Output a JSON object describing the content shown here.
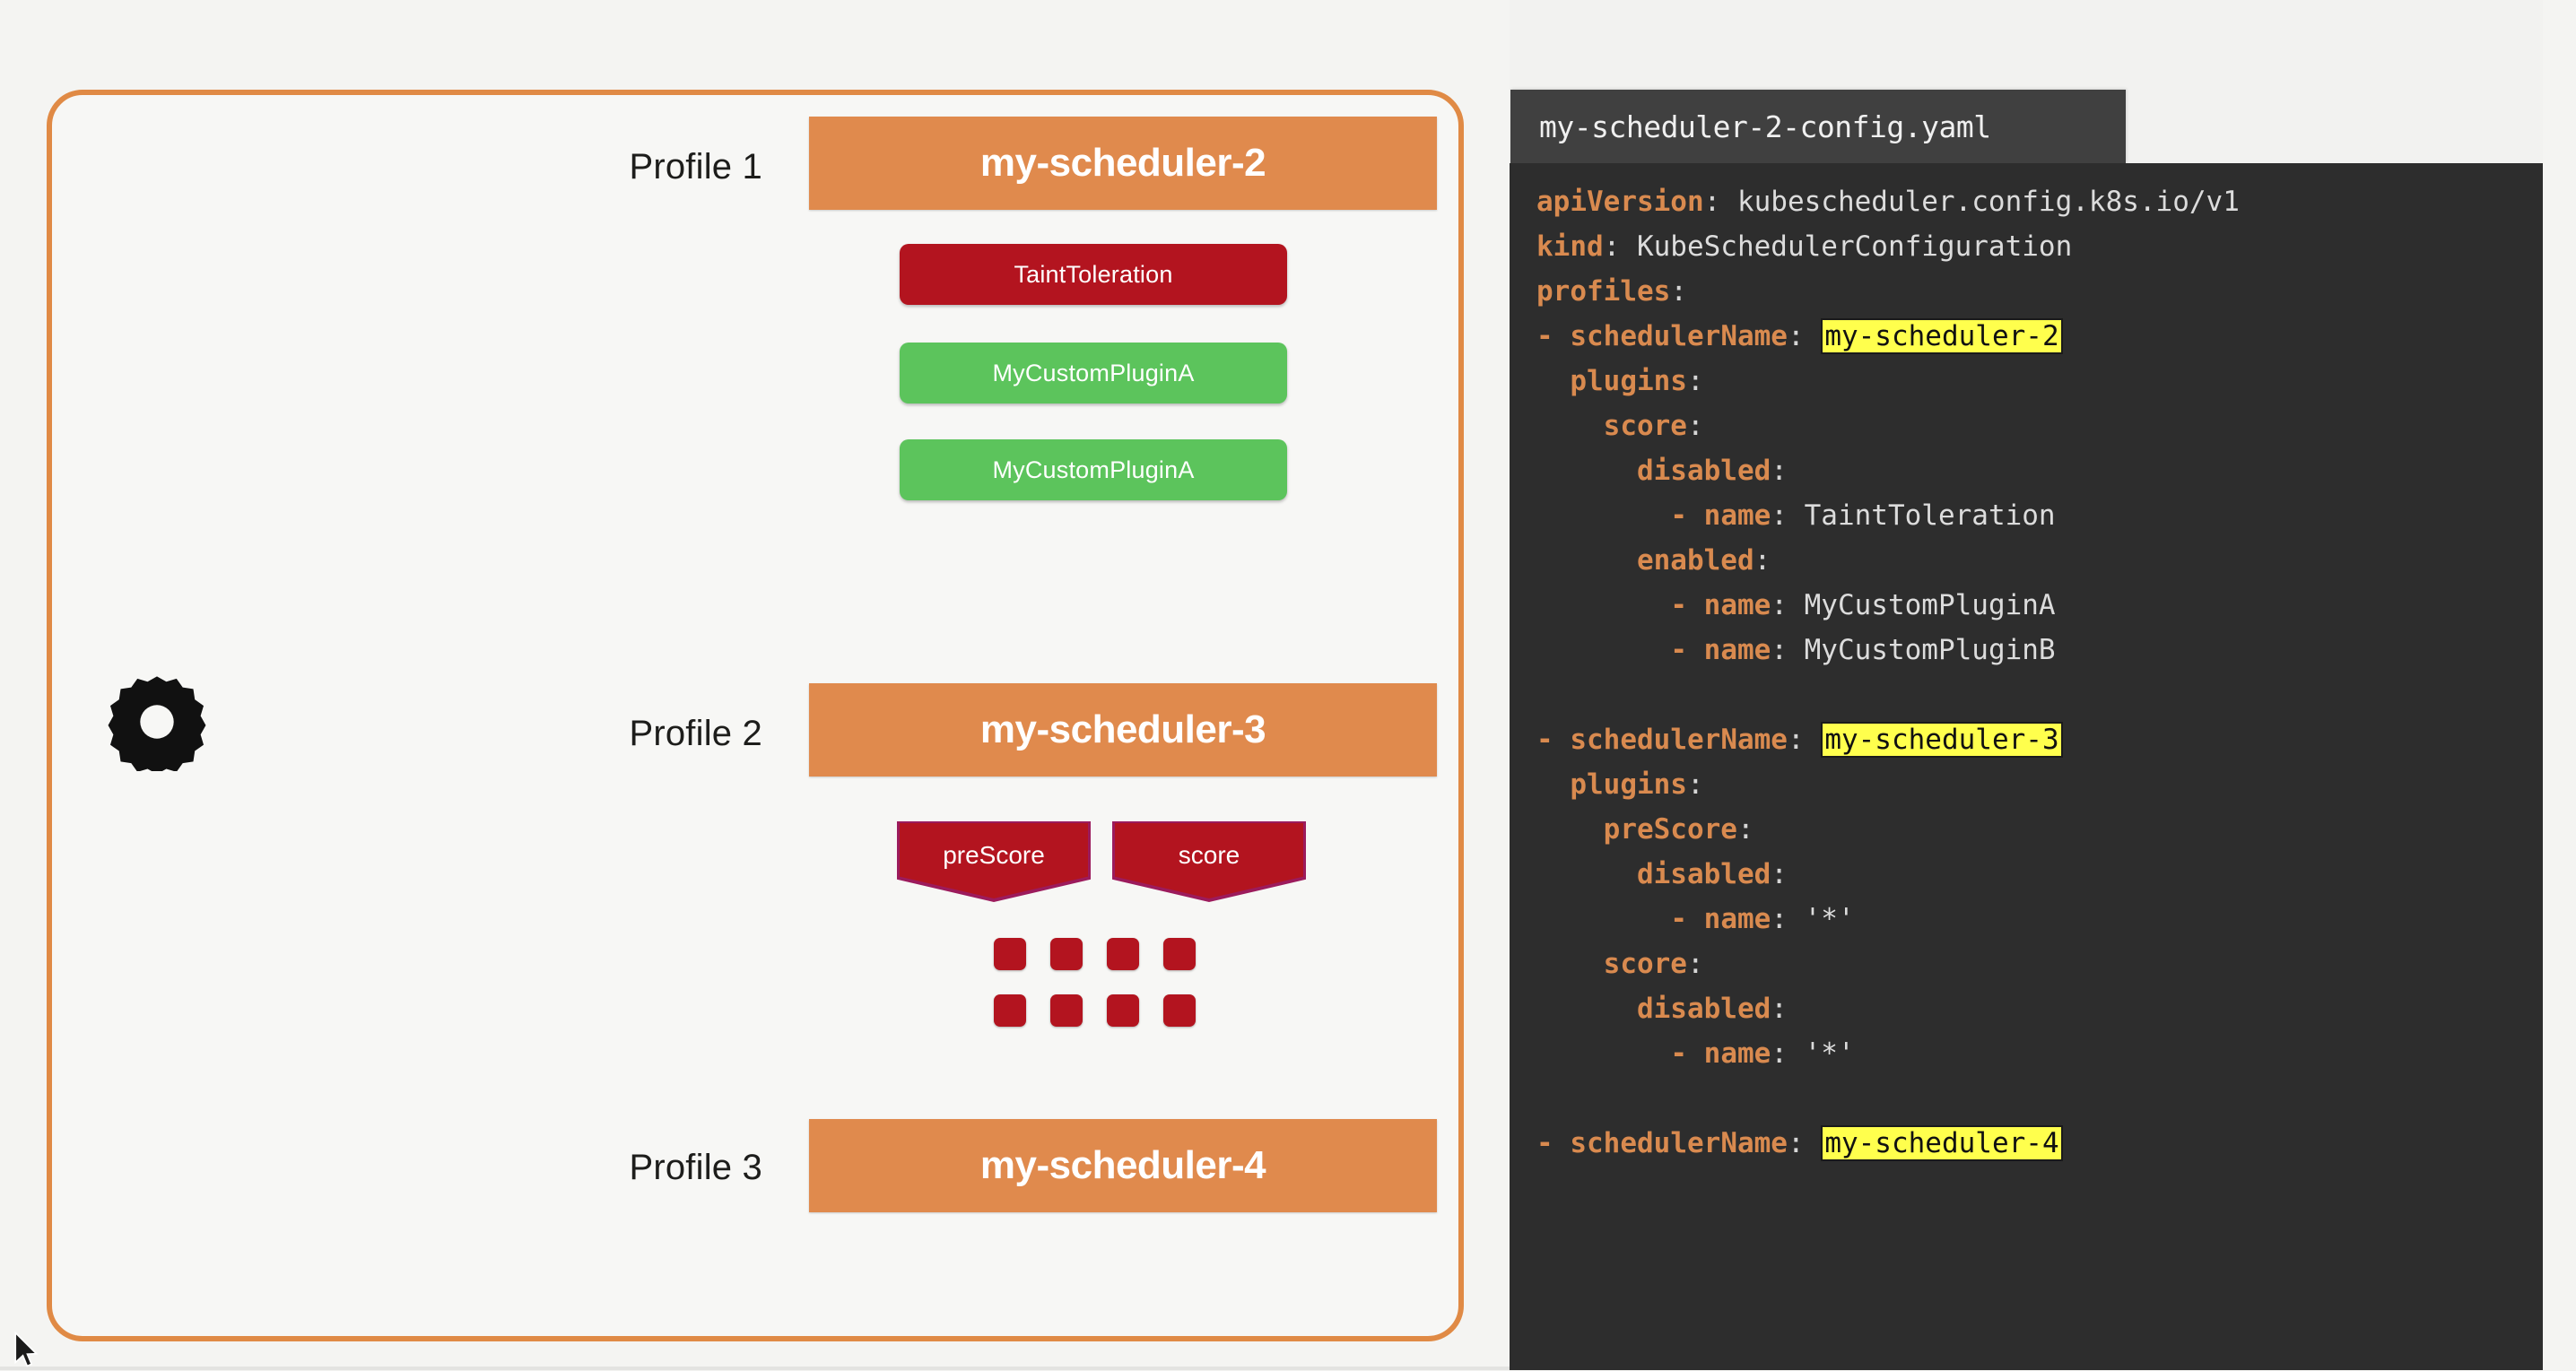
{
  "diagram": {
    "gear_icon": "gear-icon",
    "profiles": [
      {
        "label": "Profile 1",
        "scheduler_name": "my-scheduler-2",
        "plugins": [
          {
            "name": "TaintToleration",
            "state": "disabled"
          },
          {
            "name": "MyCustomPluginA",
            "state": "enabled"
          },
          {
            "name": "MyCustomPluginA",
            "state": "enabled"
          }
        ]
      },
      {
        "label": "Profile 2",
        "scheduler_name": "my-scheduler-3",
        "extension_points": [
          "preScore",
          "score"
        ],
        "plugin_squares": 8
      },
      {
        "label": "Profile 3",
        "scheduler_name": "my-scheduler-4"
      }
    ]
  },
  "code_panel": {
    "filename": "my-scheduler-2-config.yaml",
    "lines": [
      {
        "indent": 0,
        "key": "apiVersion",
        "value": "kubescheduler.config.k8s.io/v1"
      },
      {
        "indent": 0,
        "key": "kind",
        "value": "KubeSchedulerConfiguration"
      },
      {
        "indent": 0,
        "key": "profiles",
        "value": ""
      },
      {
        "indent": 0,
        "dash": true,
        "key": "schedulerName",
        "value": "my-scheduler-2",
        "highlight": true
      },
      {
        "indent": 1,
        "key": "plugins",
        "value": ""
      },
      {
        "indent": 2,
        "key": "score",
        "value": ""
      },
      {
        "indent": 3,
        "key": "disabled",
        "value": ""
      },
      {
        "indent": 4,
        "dash": true,
        "key": "name",
        "value": "TaintToleration"
      },
      {
        "indent": 3,
        "key": "enabled",
        "value": ""
      },
      {
        "indent": 4,
        "dash": true,
        "key": "name",
        "value": "MyCustomPluginA"
      },
      {
        "indent": 4,
        "dash": true,
        "key": "name",
        "value": "MyCustomPluginB"
      },
      {
        "blank": true
      },
      {
        "indent": 0,
        "dash": true,
        "key": "schedulerName",
        "value": "my-scheduler-3",
        "highlight": true
      },
      {
        "indent": 1,
        "key": "plugins",
        "value": ""
      },
      {
        "indent": 2,
        "key": "preScore",
        "value": ""
      },
      {
        "indent": 3,
        "key": "disabled",
        "value": ""
      },
      {
        "indent": 4,
        "dash": true,
        "key": "name",
        "value": "'*'"
      },
      {
        "indent": 2,
        "key": "score",
        "value": ""
      },
      {
        "indent": 3,
        "key": "disabled",
        "value": ""
      },
      {
        "indent": 4,
        "dash": true,
        "key": "name",
        "value": "'*'"
      },
      {
        "blank": true
      },
      {
        "indent": 0,
        "dash": true,
        "key": "schedulerName",
        "value": "my-scheduler-4",
        "highlight": true
      }
    ]
  },
  "colors": {
    "frame_border": "#e08a45",
    "scheduler_bar": "#e08a4d",
    "plugin_disabled": "#b3141f",
    "plugin_enabled": "#5cc45c",
    "banner_outline": "#9c1b5c",
    "code_bg": "#2d2d2d",
    "code_title_bg": "#404040",
    "code_key": "#d98a4f",
    "code_value": "#dcdcdc",
    "highlight": "#ffff4d"
  }
}
